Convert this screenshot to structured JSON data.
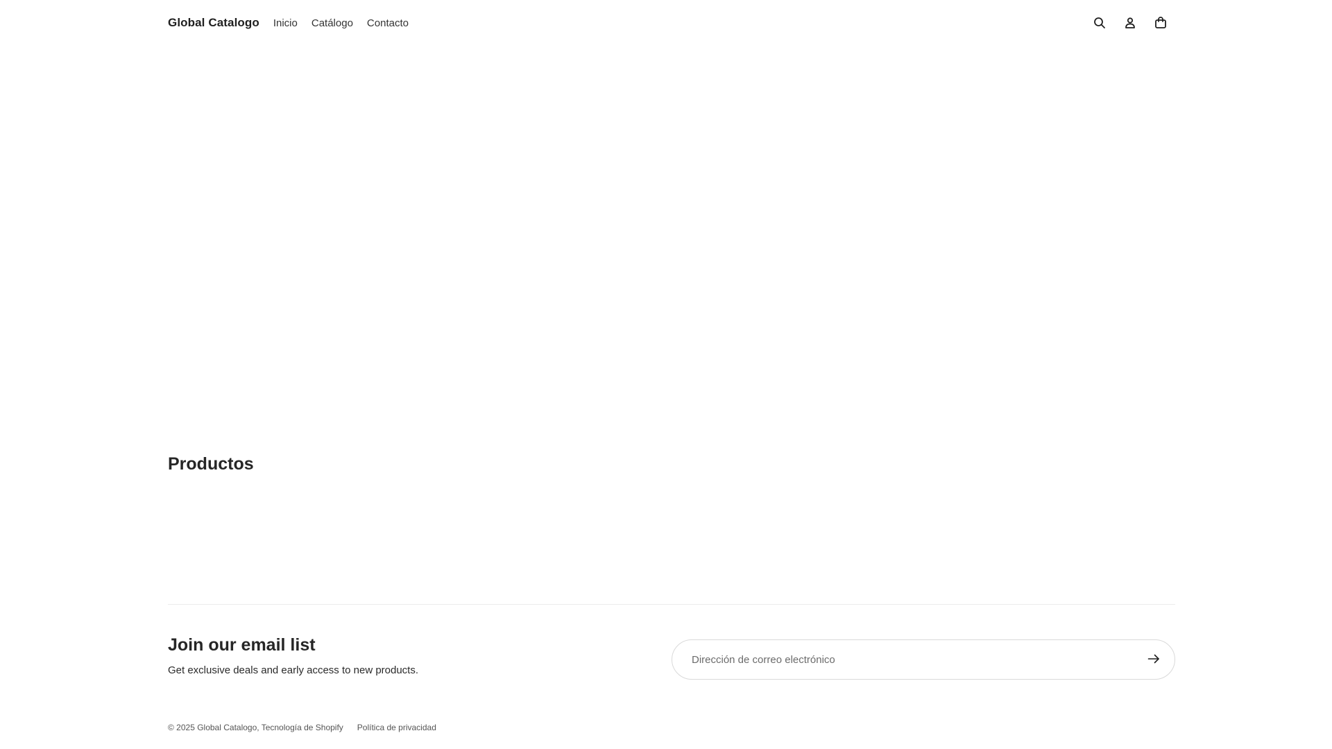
{
  "header": {
    "brand": "Global Catalogo",
    "nav": [
      {
        "label": "Inicio"
      },
      {
        "label": "Catálogo"
      },
      {
        "label": "Contacto"
      }
    ],
    "icons": [
      "search-icon",
      "account-icon",
      "cart-icon"
    ]
  },
  "products": {
    "title": "Productos"
  },
  "newsletter": {
    "title": "Join our email list",
    "subtitle": "Get exclusive deals and early access to new products.",
    "email_placeholder": "Dirección de correo electrónico",
    "submit_icon": "arrow-right-icon"
  },
  "footer": {
    "copyright": "© 2025 Global Catalogo, Tecnología de Shopify",
    "privacy_link": "Política de privacidad"
  }
}
